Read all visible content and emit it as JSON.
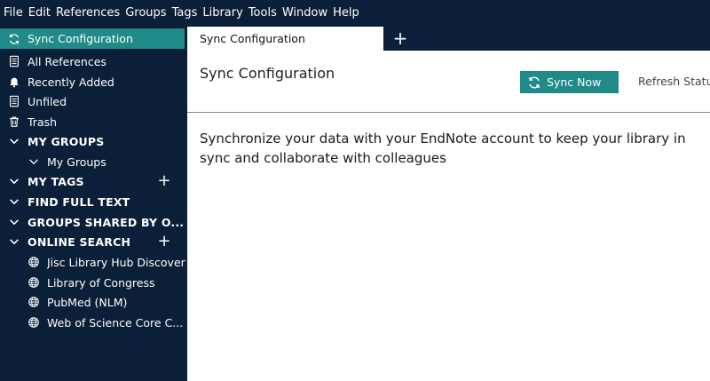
{
  "menubar": {
    "items": [
      "File",
      "Edit",
      "References",
      "Groups",
      "Tags",
      "Library",
      "Tools",
      "Window",
      "Help"
    ]
  },
  "sidebar": {
    "sync": "Sync Configuration",
    "all_references": "All References",
    "recently_added": "Recently Added",
    "unfiled": "Unfiled",
    "trash": "Trash",
    "my_groups_header": "MY GROUPS",
    "my_groups_sub": "My Groups",
    "my_tags_header": "MY TAGS",
    "find_full_text_header": "FIND FULL TEXT",
    "groups_shared_header": "GROUPS SHARED BY O...",
    "online_search_header": "ONLINE SEARCH",
    "online": [
      "Jisc Library Hub Discover",
      "Library of Congress",
      "PubMed (NLM)",
      "Web of Science Core C..."
    ]
  },
  "tabs": {
    "active": "Sync Configuration"
  },
  "main": {
    "title": "Sync Configuration",
    "sync_now": "Sync Now",
    "refresh_status": "Refresh Status",
    "description": "Synchronize your data with your EndNote account to keep your library in sync and collaborate with colleagues"
  },
  "colors": {
    "navy": "#0b1f38",
    "teal": "#1f8a88"
  },
  "icons": [
    "sync-icon",
    "document-icon",
    "bell-icon",
    "trash-icon",
    "chevron-down-icon",
    "plus-icon",
    "globe-icon"
  ]
}
